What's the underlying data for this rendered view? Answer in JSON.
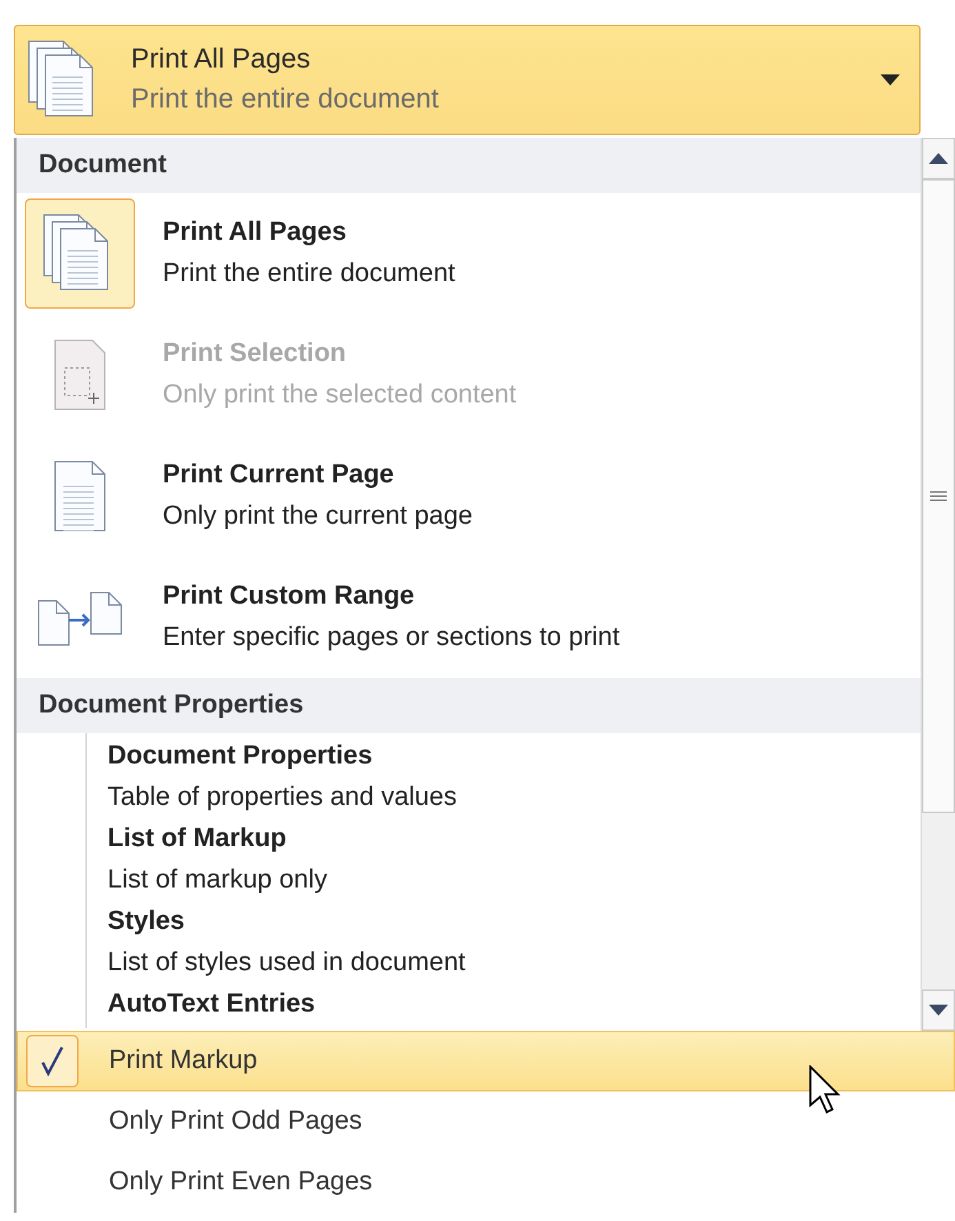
{
  "dropdown": {
    "title": "Print All Pages",
    "subtitle": "Print the entire document",
    "kind": "all-pages"
  },
  "sections": [
    {
      "heading": "Document",
      "kind": "icon-list",
      "items": [
        {
          "title": "Print All Pages",
          "description": "Print the entire document",
          "kind": "all-pages",
          "selected": true,
          "disabled": false
        },
        {
          "title": "Print Selection",
          "description": "Only print the selected content",
          "kind": "selection",
          "selected": false,
          "disabled": true
        },
        {
          "title": "Print Current Page",
          "description": "Only print the current page",
          "kind": "current-page",
          "selected": false,
          "disabled": false
        },
        {
          "title": "Print Custom Range",
          "description": "Enter specific pages or sections to print",
          "kind": "custom-range",
          "selected": false,
          "disabled": false
        }
      ]
    },
    {
      "heading": "Document Properties",
      "kind": "text-list",
      "items": [
        {
          "title": "Document Properties",
          "description": "Table of properties and values",
          "selected": false,
          "disabled": false
        },
        {
          "title": "List of Markup",
          "description": "List of markup only",
          "selected": false,
          "disabled": false
        },
        {
          "title": "Styles",
          "description": "List of styles used in document",
          "selected": false,
          "disabled": false
        },
        {
          "title": "AutoText Entries",
          "selected": false,
          "disabled": false
        }
      ]
    }
  ],
  "options": [
    {
      "label": "Print Markup",
      "checked": true,
      "highlighted": true
    },
    {
      "label": "Only Print Odd Pages",
      "checked": false,
      "highlighted": false
    },
    {
      "label": "Only Print Even Pages",
      "checked": false,
      "highlighted": false
    }
  ]
}
